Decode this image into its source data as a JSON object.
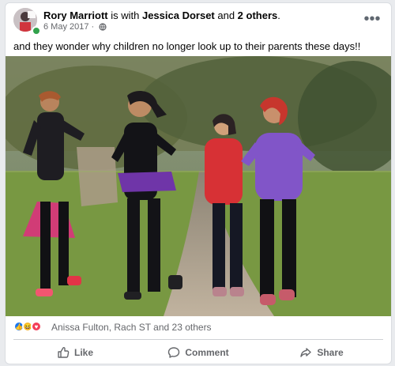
{
  "post": {
    "author_name": "Rory Marriott",
    "with_text": " is with ",
    "tagged_name": "Jessica Dorset",
    "and_text": " and ",
    "others_text": "2 others",
    "others_suffix": ".",
    "date": "6 May 2017 ·",
    "text": "and they wonder why children no longer look up to their parents these days!!"
  },
  "photo": {
    "icon_name": "photo-image"
  },
  "reactions": {
    "summary": "Anissa Fulton, Rach ST and 23 others",
    "icons": [
      "like-icon",
      "haha-icon",
      "love-icon"
    ]
  },
  "actions": {
    "like": "Like",
    "comment": "Comment",
    "share": "Share"
  },
  "colors": {
    "brand_blue": "#1877f2",
    "text_secondary": "#65676b",
    "background": "#e9ebee"
  }
}
